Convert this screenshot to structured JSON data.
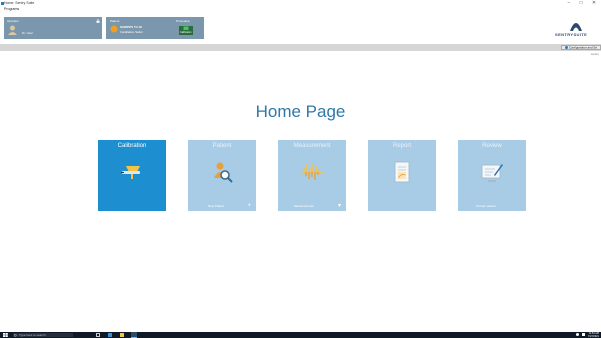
{
  "window": {
    "title": "Home: Sentry Suite",
    "minimize": "−",
    "maximize": "□",
    "close": "✕"
  },
  "menu": {
    "programs": "Programs"
  },
  "panels": {
    "operator": {
      "label": "Operator",
      "name": "Dr. User"
    },
    "patient": {
      "label": "Patient",
      "name": "SCRIPPS T4 18",
      "sub": "Installation Sailor"
    },
    "procedure": {
      "label": "Procedure",
      "value": "Calibration"
    }
  },
  "brand": {
    "name": "SENTRYSUITE"
  },
  "toolbar": {
    "config_label": "Configuration and Se"
  },
  "user": {
    "line": "sentry"
  },
  "home": {
    "title": "Home Page"
  },
  "tiles": [
    {
      "label": "Calibration",
      "footer": "",
      "action": ""
    },
    {
      "label": "Patient",
      "footer": "New Patient",
      "action": "+"
    },
    {
      "label": "Measurement",
      "footer": "Measurements",
      "action": "▾"
    },
    {
      "label": "Report",
      "footer": "",
      "action": ""
    },
    {
      "label": "Review",
      "footer": "Current patient",
      "action": ""
    }
  ],
  "taskbar": {
    "search_placeholder": "Type here to search",
    "time": "11:54 AM",
    "date": "7/27/2021"
  },
  "colors": {
    "accent": "#1d8fd0",
    "tile_inactive": "#a8cce6",
    "panel": "#7a97ad",
    "title_text": "#2f78a8"
  }
}
